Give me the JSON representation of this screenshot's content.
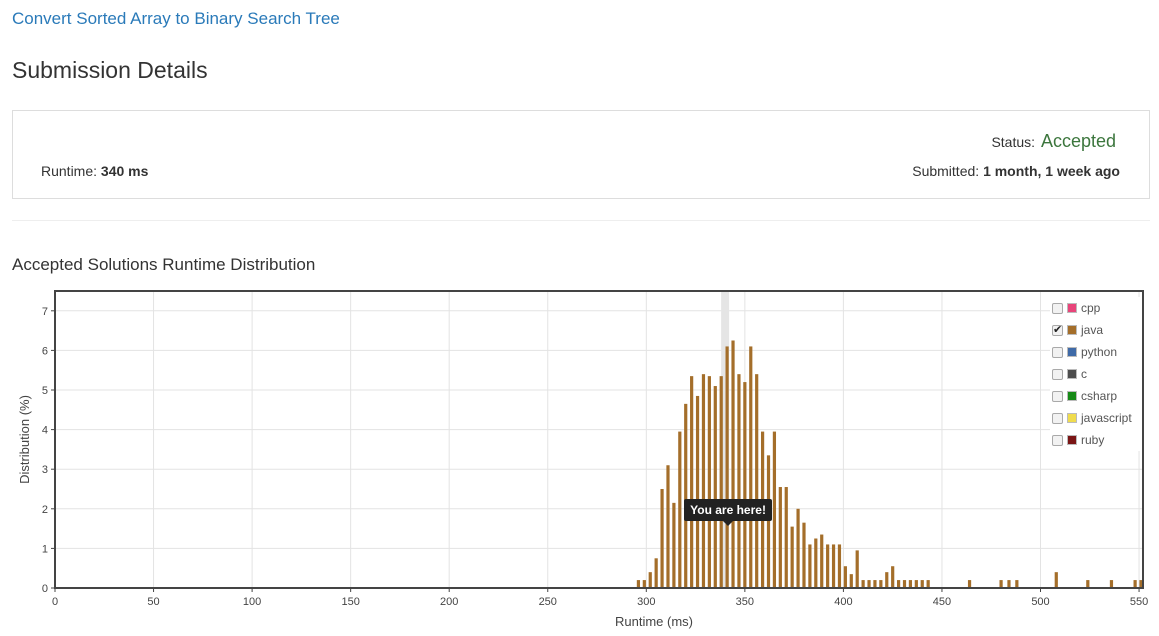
{
  "header": {
    "problem_title": "Convert Sorted Array to Binary Search Tree",
    "page_title": "Submission Details"
  },
  "details": {
    "status_label": "Status:",
    "status_value": "Accepted",
    "runtime_label": "Runtime:",
    "runtime_value": "340 ms",
    "submitted_label": "Submitted:",
    "submitted_value": "1 month, 1 week ago"
  },
  "colors": {
    "accent_link": "#2a7ab9",
    "status_accepted": "#3c763d",
    "bar": "#a46e2a",
    "highlight": "#e5e5e5"
  },
  "distribution": {
    "title": "Accepted Solutions Runtime Distribution",
    "tooltip": "You are here!",
    "legend": [
      {
        "label": "cpp",
        "color": "#e8457a",
        "checked": false
      },
      {
        "label": "java",
        "color": "#a46e2a",
        "checked": true
      },
      {
        "label": "python",
        "color": "#3f6aa7",
        "checked": false
      },
      {
        "label": "c",
        "color": "#4d4d4d",
        "checked": false
      },
      {
        "label": "csharp",
        "color": "#178a17",
        "checked": false
      },
      {
        "label": "javascript",
        "color": "#f0dc4e",
        "checked": false
      },
      {
        "label": "ruby",
        "color": "#7a1515",
        "checked": false
      }
    ]
  },
  "chart_data": {
    "type": "bar",
    "xlabel": "Runtime (ms)",
    "ylabel": "Distribution (%)",
    "xlim": [
      0,
      552
    ],
    "ylim": [
      0,
      7.5
    ],
    "xticks": [
      0,
      50,
      100,
      150,
      200,
      250,
      300,
      350,
      400,
      450,
      500,
      550
    ],
    "yticks": [
      0,
      1,
      2,
      3,
      4,
      5,
      6,
      7
    ],
    "grid": true,
    "highlight_x": 340,
    "series": [
      {
        "name": "java",
        "x": [
          296,
          299,
          302,
          305,
          308,
          311,
          314,
          317,
          320,
          323,
          326,
          329,
          332,
          335,
          338,
          341,
          344,
          347,
          350,
          353,
          356,
          359,
          362,
          365,
          368,
          371,
          374,
          377,
          380,
          383,
          386,
          389,
          392,
          395,
          398,
          401,
          404,
          407,
          410,
          413,
          416,
          419,
          422,
          425,
          428,
          431,
          434,
          437,
          440,
          443,
          464,
          480,
          484,
          488,
          508,
          524,
          536,
          548,
          551
        ],
        "values": [
          0.2,
          0.2,
          0.4,
          0.75,
          2.5,
          3.1,
          2.15,
          3.95,
          4.65,
          5.35,
          4.85,
          5.4,
          5.35,
          5.1,
          5.35,
          6.1,
          6.25,
          5.4,
          5.2,
          6.1,
          5.4,
          3.95,
          3.35,
          3.95,
          2.55,
          2.55,
          1.55,
          2.0,
          1.65,
          1.1,
          1.25,
          1.35,
          1.1,
          1.1,
          1.1,
          0.55,
          0.35,
          0.95,
          0.2,
          0.2,
          0.2,
          0.2,
          0.4,
          0.55,
          0.2,
          0.2,
          0.2,
          0.2,
          0.2,
          0.2,
          0.2,
          0.2,
          0.2,
          0.2,
          0.4,
          0.2,
          0.2,
          0.2,
          0.2
        ]
      }
    ]
  }
}
